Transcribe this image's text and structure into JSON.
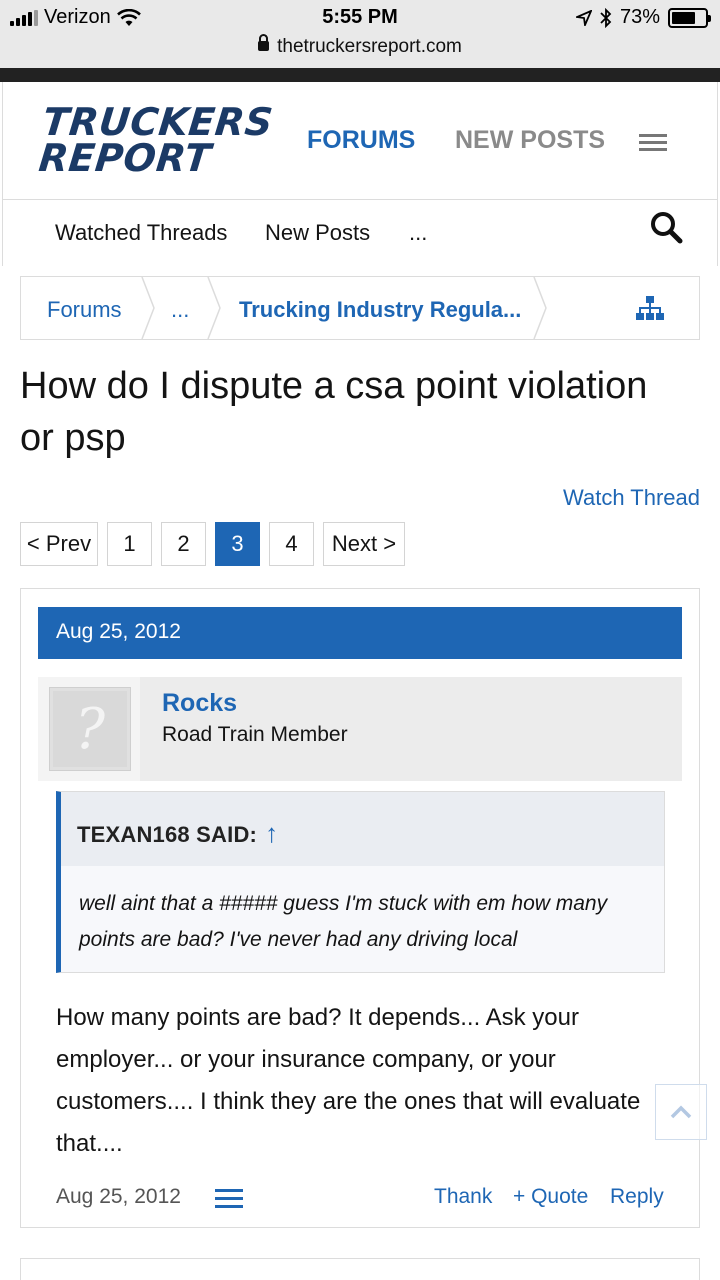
{
  "status_bar": {
    "carrier": "Verizon",
    "time": "5:55 PM",
    "battery": "73%",
    "battery_level": 0.73,
    "url": "thetruckersreport.com"
  },
  "header": {
    "logo_line1": "TRUCKERS",
    "logo_line2": "REPORT",
    "nav_forums": "FORUMS",
    "nav_new_posts": "NEW POSTS",
    "menu_icon": "hamburger-icon"
  },
  "subnav": {
    "watched_threads": "Watched Threads",
    "new_posts": "New Posts",
    "more": "...",
    "search_icon": "search-icon"
  },
  "breadcrumb": {
    "items": [
      "Forums",
      "...",
      "Trucking Industry Regula..."
    ],
    "sitemap_icon": "sitemap-icon"
  },
  "thread": {
    "title": "How do I dispute a csa point violation or psp",
    "watch_label": "Watch Thread"
  },
  "pagination": {
    "prev": "< Prev",
    "pages": [
      "1",
      "2",
      "3",
      "4"
    ],
    "current": "3",
    "next": "Next >"
  },
  "post": {
    "date": "Aug 25, 2012",
    "username": "Rocks",
    "user_title": "Road Train Member",
    "avatar_glyph": "?",
    "quote_author": "TEXAN168 SAID:",
    "quote_arrow": "↑",
    "quote_text": "well aint that a ##### guess I'm stuck with em how many points are bad? I've never had any driving local",
    "message": "How many points are bad? It depends... Ask your employer... or your insurance company, or your customers.... I think they are the ones that will evaluate that....",
    "footer_date": "Aug 25, 2012",
    "actions": {
      "thank": "Thank",
      "quote": "+ Quote",
      "reply": "Reply"
    }
  },
  "colors": {
    "accent": "#1e66b4",
    "logo": "#1b3a66",
    "muted_nav": "#8a8a8a"
  }
}
